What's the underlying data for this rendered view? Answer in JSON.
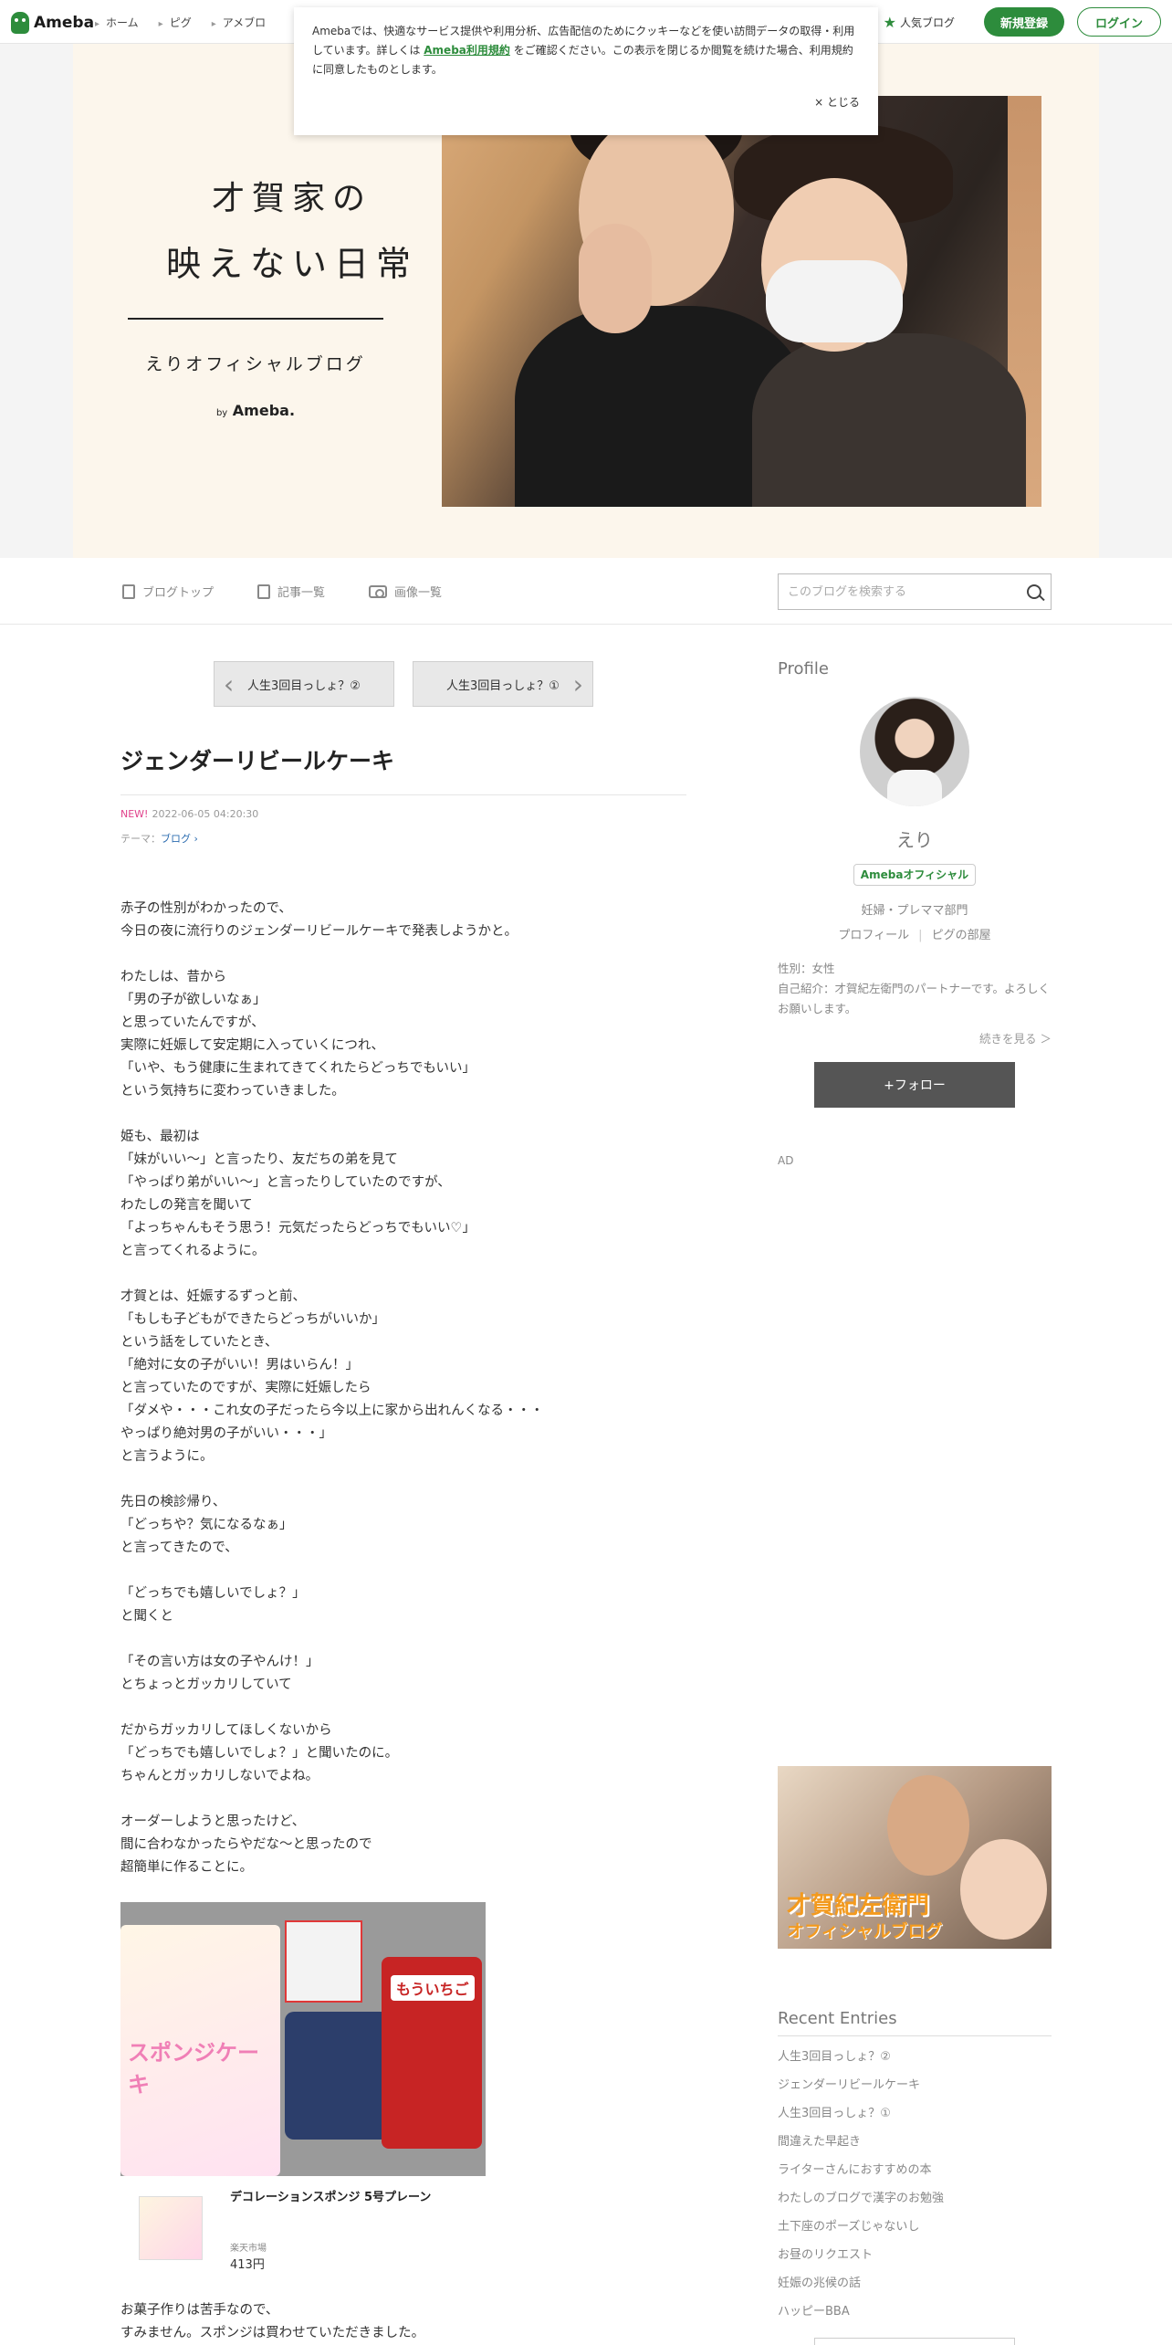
{
  "topnav": {
    "logo": "Ameba",
    "links": [
      "ホーム",
      "ピグ",
      "アメブロ"
    ],
    "popular": "人気ブログ",
    "register": "新規登録",
    "login": "ログイン"
  },
  "cookie": {
    "text_before": "Amebaでは、快適なサービス提供や利用分析、広告配信のためにクッキーなどを使い訪問データの取得・利用しています。詳しくは ",
    "link": "Ameba利用規約",
    "text_after": " をご確認ください。この表示を閉じるか閲覧を続けた場合、利用規約に同意したものとします。",
    "close": "× とじる"
  },
  "header": {
    "title_line1": "才賀家の",
    "title_line2": "映えない日常",
    "subtitle": "えりオフィシャルブログ",
    "by": "by",
    "brand": "Ameba."
  },
  "blognav": {
    "top": "ブログトップ",
    "entries": "記事一覧",
    "images": "画像一覧",
    "search_placeholder": "このブログを検索する"
  },
  "pager": {
    "prev": "人生3回目っしょ？②",
    "next": "人生3回目っしょ？①"
  },
  "article": {
    "title": "ジェンダーリビールケーキ",
    "new_label": "NEW!",
    "date": "2022-06-05 04:20:30",
    "theme_label": "テーマ：",
    "theme": "ブログ ›",
    "paragraphs": [
      [
        "赤子の性別がわかったので、",
        "今日の夜に流行りのジェンダーリビールケーキで発表しようかと。"
      ],
      [
        "わたしは、昔から",
        "「男の子が欲しいなぁ」",
        "と思っていたんですが、",
        "実際に妊娠して安定期に入っていくにつれ、",
        "「いや、もう健康に生まれてきてくれたらどっちでもいい」",
        "という気持ちに変わっていきました。"
      ],
      [
        "姫も、最初は",
        "「妹がいい〜」と言ったり、友だちの弟を見て",
        "「やっぱり弟がいい〜」と言ったりしていたのですが、",
        "わたしの発言を聞いて",
        "「よっちゃんもそう思う！元気だったらどっちでもいい♡」",
        "と言ってくれるように。"
      ],
      [
        "才賀とは、妊娠するずっと前、",
        "「もしも子どもができたらどっちがいいか」",
        "という話をしていたとき、",
        "「絶対に女の子がいい！男はいらん！」",
        "と言っていたのですが、実際に妊娠したら",
        "「ダメや・・・これ女の子だったら今以上に家から出れんくなる・・・",
        "やっぱり絶対男の子がいい・・・」",
        "と言うように。"
      ],
      [
        "先日の検診帰り、",
        "「どっちや？気になるなぁ」",
        "と言ってきたので、"
      ],
      [
        "「どっちでも嬉しいでしょ？」",
        "と聞くと"
      ],
      [
        "「その言い方は女の子やんけ！」",
        "とちょっとガッカリしていて"
      ],
      [
        "だからガッカリしてほしくないから",
        "「どっちでも嬉しいでしょ？」と聞いたのに。",
        "ちゃんとガッカリしないでよね。"
      ],
      [
        "オーダーしようと思ったけど、",
        "間に合わなかったらやだな〜と思ったので",
        "超簡単に作ることに。"
      ]
    ],
    "image_labels": {
      "sponge": "スポンジケーキ",
      "strawberry": "もういちご"
    },
    "product": {
      "name": "デコレーションスポンジ 5号プレーン",
      "shop": "楽天市場",
      "price": "413円"
    },
    "tail": [
      "お菓子作りは苦手なので、",
      "すみません。スポンジは買わせていただきました。"
    ]
  },
  "sidebar": {
    "profile_heading": "Profile",
    "name": "えり",
    "badge": "Amebaオフィシャル",
    "dept": "妊婦・プレママ部門",
    "link_profile": "プロフィール",
    "link_room": "ピグの部屋",
    "gender": "性別：女性",
    "intro": "自己紹介：才賀紀左衛門のパートナーです。よろしくお願いします。",
    "more": "続きを見る ＞",
    "follow": "+フォロー",
    "ad": "AD",
    "banner_line1": "才賀紀左衛門",
    "banner_line2": "オフィシャルブログ",
    "recent_heading": "Recent Entries",
    "recent": [
      "人生3回目っしょ？②",
      "ジェンダーリビールケーキ",
      "人生3回目っしょ？①",
      "間違えた早起き",
      "ライターさんにおすすめの本",
      "わたしのブログで漢字のお勉強",
      "土下座のポーズじゃないし",
      "お昼のリクエスト",
      "妊娠の兆候の話",
      "ハッピーBBA"
    ]
  },
  "colors": {
    "accent": "#2d8c3c",
    "new_badge": "#e0408a",
    "header_bg": "#fcf6ec"
  }
}
